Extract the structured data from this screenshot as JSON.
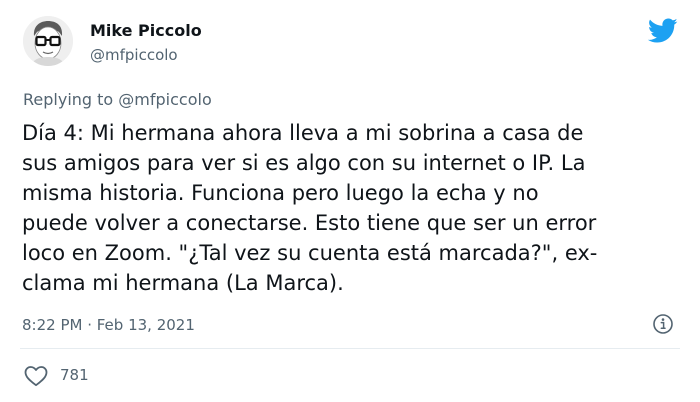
{
  "author": {
    "name": "Mike Piccolo",
    "handle": "@mfpiccolo"
  },
  "reply": {
    "label": "Replying to",
    "to": "@mfpiccolo"
  },
  "tweet": {
    "lines": [
      "Día 4: Mi hermana ahora lleva a mi sobrina a casa de",
      "sus amigos para ver si es algo con su internet o IP. La",
      "misma historia. Funciona pero luego la echa y no",
      "puede volver a conectarse. Esto tiene que ser un error",
      "loco en Zoom. \"¿Tal vez su cuenta está marcada?\", ex-",
      "clama mi hermana (La Marca)."
    ],
    "timestamp": "8:22 PM · Feb 13, 2021"
  },
  "stats": {
    "likes": "781"
  },
  "icons": {
    "brand": "twitter-bird-icon",
    "info": "info-icon",
    "like": "heart-icon"
  },
  "colors": {
    "brand": "#1da1f2",
    "secondary_text": "#536471",
    "primary_text": "#0f1419"
  }
}
